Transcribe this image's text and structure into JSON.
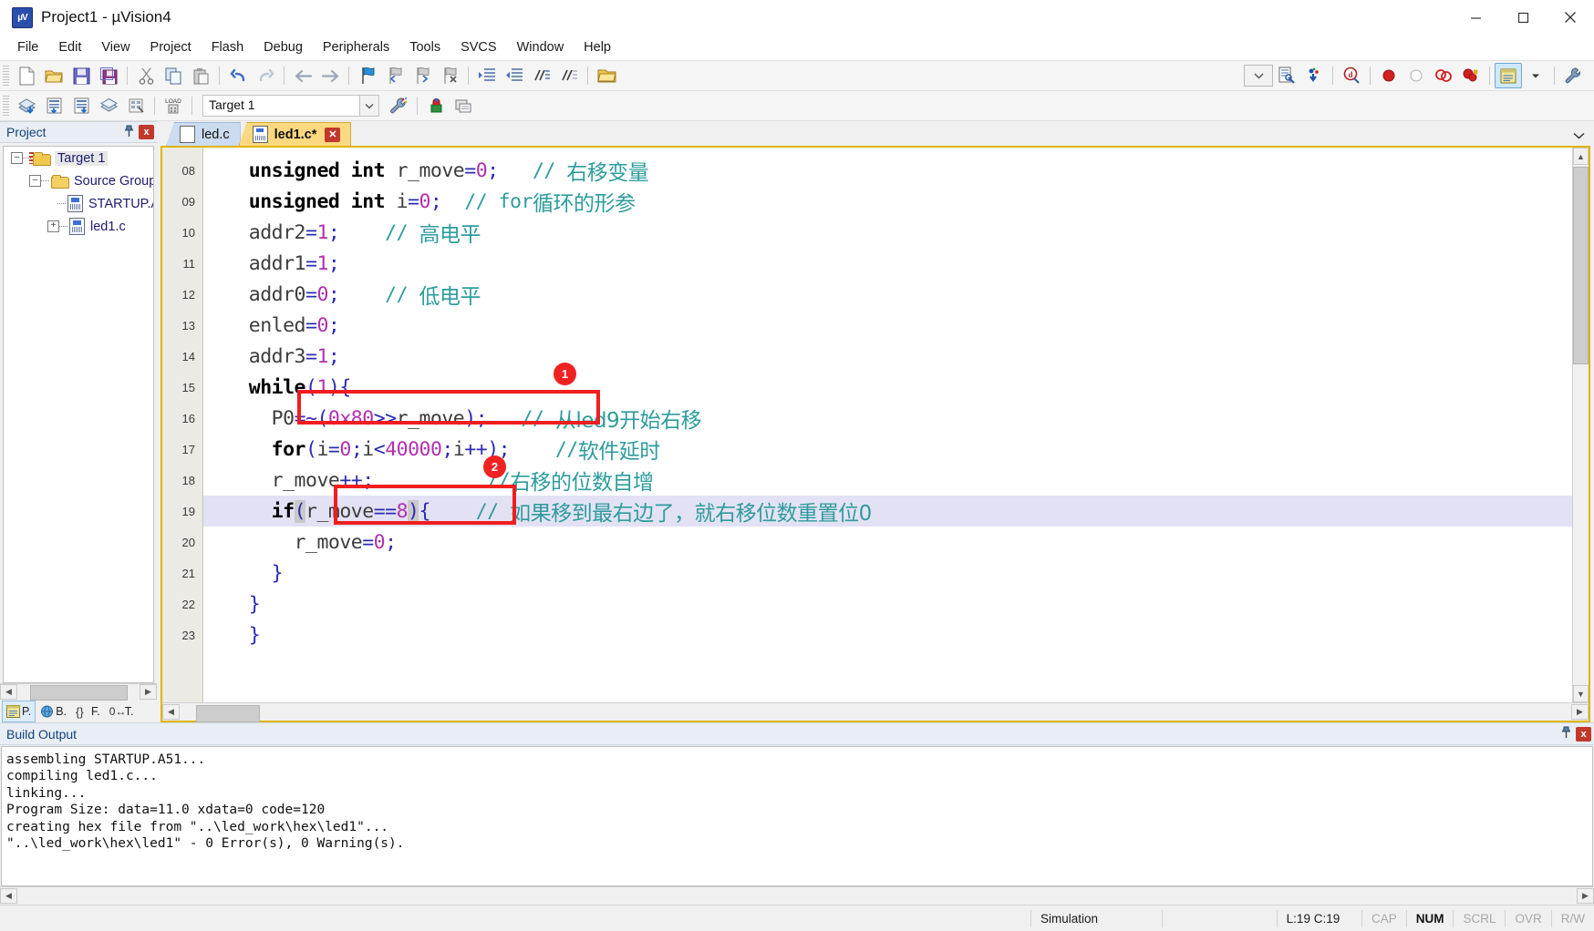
{
  "window": {
    "title": "Project1  - µVision4",
    "app_icon": "uvision-logo-icon",
    "minimize": "–",
    "maximize": "□",
    "close": "✕"
  },
  "menubar": [
    "File",
    "Edit",
    "View",
    "Project",
    "Flash",
    "Debug",
    "Peripherals",
    "Tools",
    "SVCS",
    "Window",
    "Help"
  ],
  "toolbar1": [
    "new-file-icon",
    "open-file-icon",
    "save-icon",
    "save-all-icon",
    "cut-icon",
    "copy-icon",
    "paste-icon",
    "undo-icon",
    "redo-icon",
    "back-icon",
    "forward-icon",
    "bookmark-toggle-icon",
    "bookmark-prev-icon",
    "bookmark-next-icon",
    "bookmark-clear-icon",
    "indent-icon",
    "outdent-icon",
    "comment-icon",
    "uncomment-icon",
    "open-folder-icon"
  ],
  "toolbar1_right": [
    "combo-dropdown",
    "find-in-files-icon",
    "configure-icon",
    "debug-start-icon",
    "breakpoint-insert-icon",
    "breakpoint-disable-icon",
    "breakpoint-kill-all-icon",
    "breakpoint-disable-all-icon",
    "project-window-icon",
    "dropdown-arrow-icon",
    "configure-target-icon"
  ],
  "toolbar2": {
    "icons_left": [
      "build-target-icon",
      "translate-icon",
      "build-icon",
      "rebuild-all-icon",
      "batch-build-icon",
      "download-icon"
    ],
    "target_value": "Target 1",
    "target_dropdown": "chevron-down-icon",
    "icons_right": [
      "target-options-icon",
      "manage-components-icon",
      "manage-project-items-icon"
    ]
  },
  "project_pane": {
    "title": "Project",
    "pin": "auto-hide-pin-icon",
    "close": "x",
    "tree": [
      {
        "label": "Target 1",
        "expander": "–",
        "icon": "target-folder-icon",
        "level": 0,
        "selected": true
      },
      {
        "label": "Source Group",
        "expander": "–",
        "icon": "folder-icon",
        "level": 1,
        "selected": false
      },
      {
        "label": "STARTUP.A",
        "expander": "",
        "icon": "file-icon",
        "level": 2,
        "selected": false
      },
      {
        "label": "led1.c",
        "expander": "+",
        "icon": "file-icon",
        "level": 2,
        "selected": false
      }
    ],
    "bottom_tabs": [
      {
        "label": "P.",
        "icon": "project-icon",
        "active": true
      },
      {
        "label": "B.",
        "icon": "books-icon",
        "active": false
      },
      {
        "label": "F.",
        "icon": "functions-icon",
        "active": false
      },
      {
        "label": "T.",
        "icon": "templates-icon",
        "active": false
      }
    ]
  },
  "editor": {
    "tabs": [
      {
        "label": "led.c",
        "active": false,
        "modified": false,
        "closable": false
      },
      {
        "label": "led1.c*",
        "active": true,
        "modified": true,
        "closable": true
      }
    ],
    "overflow": "chevron-down-icon",
    "lines": [
      {
        "num": "08",
        "tokens": [
          {
            "t": "    ",
            "c": "id"
          },
          {
            "t": "unsigned int ",
            "c": "kw"
          },
          {
            "t": "r_move",
            "c": "id"
          },
          {
            "t": "=",
            "c": "op"
          },
          {
            "t": "0",
            "c": "num"
          },
          {
            "t": ";",
            "c": "op"
          },
          {
            "t": "   ",
            "c": "id"
          },
          {
            "t": "// ",
            "c": "cm"
          },
          {
            "t": "右移变量",
            "c": "cmcn"
          }
        ]
      },
      {
        "num": "09",
        "tokens": [
          {
            "t": "    ",
            "c": "id"
          },
          {
            "t": "unsigned int ",
            "c": "kw"
          },
          {
            "t": "i",
            "c": "id"
          },
          {
            "t": "=",
            "c": "op"
          },
          {
            "t": "0",
            "c": "num"
          },
          {
            "t": ";",
            "c": "op"
          },
          {
            "t": "  ",
            "c": "id"
          },
          {
            "t": "// ",
            "c": "cm"
          },
          {
            "t": "for",
            "c": "cm"
          },
          {
            "t": "循环的形参",
            "c": "cmcn"
          }
        ]
      },
      {
        "num": "10",
        "tokens": [
          {
            "t": "    addr2",
            "c": "id"
          },
          {
            "t": "=",
            "c": "op"
          },
          {
            "t": "1",
            "c": "num"
          },
          {
            "t": ";",
            "c": "op"
          },
          {
            "t": "    ",
            "c": "id"
          },
          {
            "t": "// ",
            "c": "cm"
          },
          {
            "t": "高电平",
            "c": "cmcn"
          }
        ]
      },
      {
        "num": "11",
        "tokens": [
          {
            "t": "    addr1",
            "c": "id"
          },
          {
            "t": "=",
            "c": "op"
          },
          {
            "t": "1",
            "c": "num"
          },
          {
            "t": ";",
            "c": "op"
          }
        ]
      },
      {
        "num": "12",
        "tokens": [
          {
            "t": "    addr0",
            "c": "id"
          },
          {
            "t": "=",
            "c": "op"
          },
          {
            "t": "0",
            "c": "num"
          },
          {
            "t": ";",
            "c": "op"
          },
          {
            "t": "    ",
            "c": "id"
          },
          {
            "t": "// ",
            "c": "cm"
          },
          {
            "t": "低电平",
            "c": "cmcn"
          }
        ]
      },
      {
        "num": "13",
        "tokens": [
          {
            "t": "    enled",
            "c": "id"
          },
          {
            "t": "=",
            "c": "op"
          },
          {
            "t": "0",
            "c": "num"
          },
          {
            "t": ";",
            "c": "op"
          }
        ]
      },
      {
        "num": "14",
        "tokens": [
          {
            "t": "    addr3",
            "c": "id"
          },
          {
            "t": "=",
            "c": "op"
          },
          {
            "t": "1",
            "c": "num"
          },
          {
            "t": ";",
            "c": "op"
          }
        ]
      },
      {
        "num": "15",
        "tokens": [
          {
            "t": "    ",
            "c": "id"
          },
          {
            "t": "while",
            "c": "kw"
          },
          {
            "t": "(",
            "c": "op"
          },
          {
            "t": "1",
            "c": "num"
          },
          {
            "t": ")",
            "c": "op"
          },
          {
            "t": "{",
            "c": "op"
          }
        ]
      },
      {
        "num": "16",
        "tokens": [
          {
            "t": "      P0",
            "c": "id"
          },
          {
            "t": "=~(",
            "c": "op"
          },
          {
            "t": "0x80",
            "c": "num"
          },
          {
            "t": ">>",
            "c": "op"
          },
          {
            "t": "r_move",
            "c": "id"
          },
          {
            "t": ")",
            "c": "op"
          },
          {
            "t": ";",
            "c": "op"
          },
          {
            "t": "   ",
            "c": "id"
          },
          {
            "t": "// ",
            "c": "cm"
          },
          {
            "t": "从led9开始右移",
            "c": "cmcn"
          }
        ]
      },
      {
        "num": "17",
        "tokens": [
          {
            "t": "      ",
            "c": "id"
          },
          {
            "t": "for",
            "c": "kw"
          },
          {
            "t": "(",
            "c": "op"
          },
          {
            "t": "i",
            "c": "id"
          },
          {
            "t": "=",
            "c": "op"
          },
          {
            "t": "0",
            "c": "num"
          },
          {
            "t": ";",
            "c": "op"
          },
          {
            "t": "i",
            "c": "id"
          },
          {
            "t": "<",
            "c": "op"
          },
          {
            "t": "40000",
            "c": "num"
          },
          {
            "t": ";",
            "c": "op"
          },
          {
            "t": "i",
            "c": "id"
          },
          {
            "t": "++)",
            "c": "op"
          },
          {
            "t": ";",
            "c": "op"
          },
          {
            "t": "    ",
            "c": "id"
          },
          {
            "t": "//",
            "c": "cm"
          },
          {
            "t": "软件延时",
            "c": "cmcn"
          }
        ]
      },
      {
        "num": "18",
        "tokens": [
          {
            "t": "      r_move",
            "c": "id"
          },
          {
            "t": "++",
            "c": "op"
          },
          {
            "t": ";",
            "c": "op"
          },
          {
            "t": "          ",
            "c": "id"
          },
          {
            "t": "//",
            "c": "cm"
          },
          {
            "t": "右移的位数自增",
            "c": "cmcn"
          }
        ]
      },
      {
        "num": "19",
        "tokens": [
          {
            "t": "      ",
            "c": "id"
          },
          {
            "t": "if",
            "c": "kw"
          },
          {
            "t": "(",
            "c": "op brace-hl"
          },
          {
            "t": "r_move",
            "c": "id"
          },
          {
            "t": "==",
            "c": "op"
          },
          {
            "t": "8",
            "c": "num"
          },
          {
            "t": ")",
            "c": "op brace-hl"
          },
          {
            "t": "{",
            "c": "op"
          },
          {
            "t": "    ",
            "c": "id"
          },
          {
            "t": "// ",
            "c": "cm"
          },
          {
            "t": "如果移到最右边了，就右移位数重置位0",
            "c": "cmcn"
          }
        ],
        "highlight": true
      },
      {
        "num": "20",
        "tokens": [
          {
            "t": "        r_move",
            "c": "id"
          },
          {
            "t": "=",
            "c": "op"
          },
          {
            "t": "0",
            "c": "num"
          },
          {
            "t": ";",
            "c": "op"
          }
        ]
      },
      {
        "num": "21",
        "tokens": [
          {
            "t": "      }",
            "c": "op"
          }
        ]
      },
      {
        "num": "22",
        "tokens": [
          {
            "t": "    }",
            "c": "op"
          }
        ]
      },
      {
        "num": "23",
        "tokens": [
          {
            "t": "    }",
            "c": "op"
          }
        ]
      }
    ],
    "annotations": [
      {
        "badge": "1",
        "target_line": 16
      },
      {
        "badge": "2",
        "target_line": 19
      }
    ]
  },
  "build_output": {
    "title": "Build Output",
    "pin": "auto-hide-pin-icon",
    "close": "x",
    "text": "assembling STARTUP.A51...\ncompiling led1.c...\nlinking...\nProgram Size: data=11.0 xdata=0 code=120\ncreating hex file from \"..\\led_work\\hex\\led1\"...\n\"..\\led_work\\hex\\led1\" - 0 Error(s), 0 Warning(s)."
  },
  "statusbar": {
    "left": "",
    "simulation": "Simulation",
    "middle": "",
    "cursor": "L:19 C:19",
    "cap": "CAP",
    "num": "NUM",
    "scrl": "SCRL",
    "ovr": "OVR",
    "rw": "R/W"
  },
  "colors": {
    "accent_yellow": "#fcd980",
    "tab_blue": "#cbdcf0",
    "annotation_red": "#f01e1e",
    "comment_teal": "#2e9c9c",
    "keyword_black": "#000000",
    "number_magenta": "#b030b0",
    "operator_blue": "#2b2bb5",
    "highlight_row": "#e3e2f4"
  }
}
